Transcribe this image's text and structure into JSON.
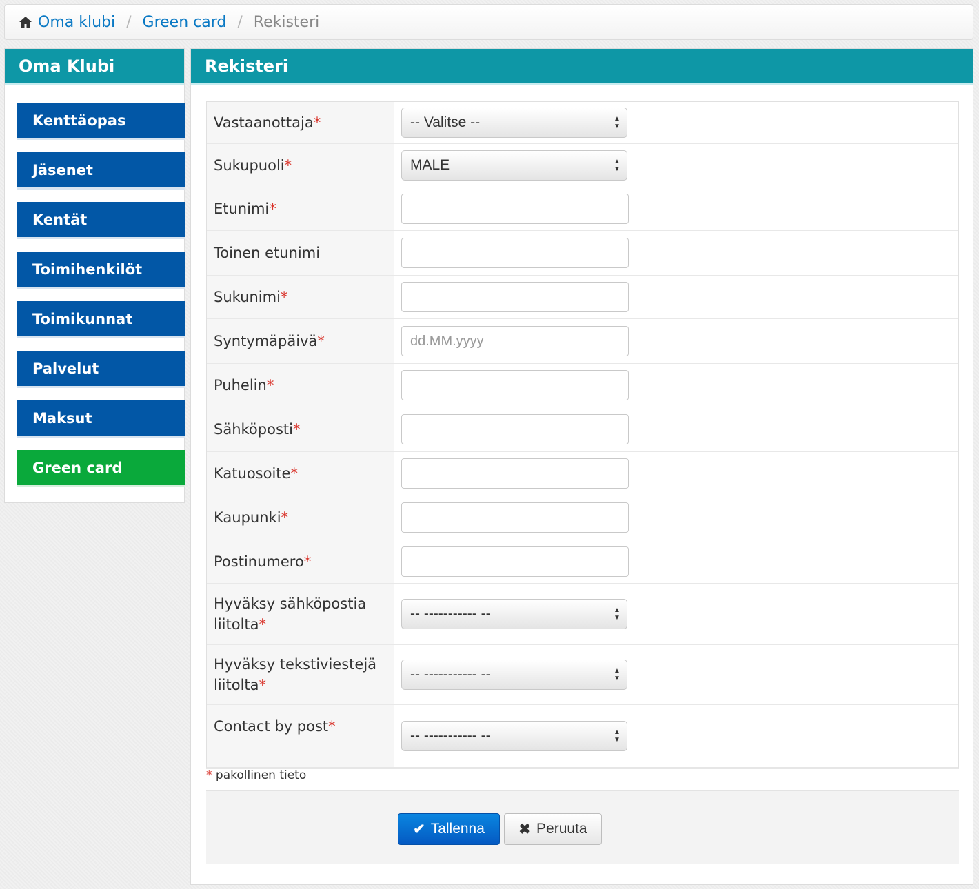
{
  "breadcrumb": {
    "home": "Oma klubi",
    "section": "Green card",
    "current": "Rekisteri",
    "separator": "/"
  },
  "sidebar": {
    "title": "Oma Klubi",
    "items": [
      {
        "label": "Kenttäopas",
        "active": false
      },
      {
        "label": "Jäsenet",
        "active": false
      },
      {
        "label": "Kentät",
        "active": false
      },
      {
        "label": "Toimihenkilöt",
        "active": false
      },
      {
        "label": "Toimikunnat",
        "active": false
      },
      {
        "label": "Palvelut",
        "active": false
      },
      {
        "label": "Maksut",
        "active": false
      },
      {
        "label": "Green card",
        "active": true
      }
    ]
  },
  "main": {
    "title": "Rekisteri",
    "fields": [
      {
        "label": "Vastaanottaja",
        "type": "select",
        "value": "-- Valitse --"
      },
      {
        "label": "Sukupuoli",
        "type": "select",
        "value": "MALE"
      },
      {
        "label": "Etunimi",
        "type": "text",
        "value": ""
      },
      {
        "label": "Toinen etunimi",
        "type": "text",
        "value": ""
      },
      {
        "label": "Sukunimi",
        "type": "text",
        "value": ""
      },
      {
        "label": "Syntymäpäivä",
        "type": "text",
        "value": "",
        "placeholder": "dd.MM.yyyy"
      },
      {
        "label": "Puhelin",
        "type": "text",
        "value": ""
      },
      {
        "label": "Sähköposti",
        "type": "text",
        "value": ""
      },
      {
        "label": "Katuosoite",
        "type": "text",
        "value": ""
      },
      {
        "label": "Kaupunki",
        "type": "text",
        "value": ""
      },
      {
        "label": "Postinumero",
        "type": "text",
        "value": ""
      },
      {
        "label": "Hyväksy sähköpostia liitolta",
        "type": "select",
        "value": "-- ----------- --"
      },
      {
        "label": "Hyväksy tekstiviestejä liitolta",
        "type": "select",
        "value": "-- ----------- --"
      },
      {
        "label": "Contact by post",
        "type": "select",
        "value": "-- ----------- --"
      }
    ],
    "required_marker": "*",
    "required_note": "pakollinen tieto",
    "save_label": "Tallenna",
    "cancel_label": "Peruuta"
  },
  "colors": {
    "panel_header": "#0e97a6",
    "nav_item": "#0257a6",
    "nav_item_active": "#0aa93b",
    "link": "#0a79c4",
    "required": "#d9342b",
    "primary_button": "#0459c2"
  },
  "icons": {
    "breadcrumb_home": "home-icon",
    "save": "checkmark-icon",
    "cancel": "close-icon",
    "select": "updown-arrows-icon"
  }
}
